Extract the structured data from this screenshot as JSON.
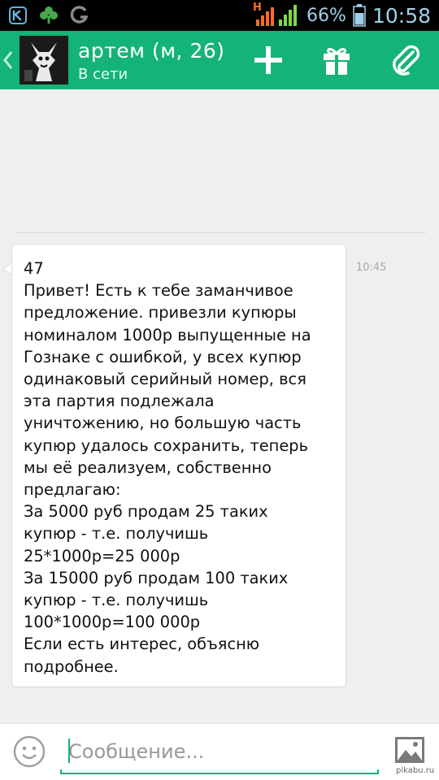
{
  "status_bar": {
    "left_icons": [
      "vk-icon",
      "clover-icon",
      "g-icon"
    ],
    "network_label": "H",
    "battery": "66%",
    "time": "10:58",
    "colors": {
      "text": "#9fd0e8",
      "signal": "#7fd84a",
      "network": "#ff6a2a"
    }
  },
  "header": {
    "title": "артем (м, 26)",
    "subtitle": "В сети",
    "actions": [
      "add-icon",
      "gift-icon",
      "attach-icon"
    ],
    "accent": "#14b378"
  },
  "conversation": {
    "messages": [
      {
        "text": "47\nПривет! Есть к тебе заманчивое\nпредложение. привезли купюры\nноминалом 1000р выпущенные на\nГознаке с ошибкой, у всех купюр\nодинаковый серийный номер, вся\nэта партия подлежала\nуничтожению, но большую часть\nкупюр удалось сохранить, теперь\nмы её реализуем, собственно\nпредлагаю:\nЗа 5000 руб продам 25 таких\nкупюр - т.е. получишь\n25*1000р=25 000р\nЗа 15000 руб продам 100 таких\nкупюр - т.е. получишь\n100*1000р=100 000р\nЕсли есть интерес, объясню\nподробнее.",
        "time": "10:45"
      }
    ]
  },
  "composer": {
    "placeholder": "Сообщение...",
    "value": ""
  },
  "watermark": "pikabu.ru"
}
